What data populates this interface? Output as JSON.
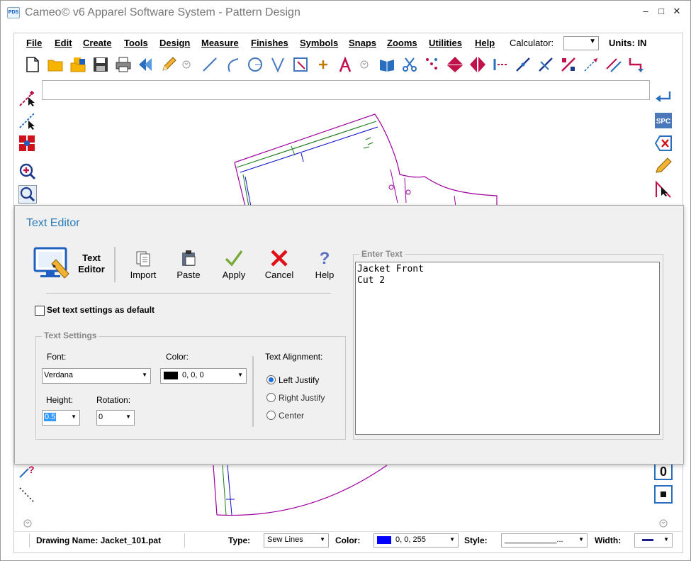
{
  "window": {
    "title": "Cameo© v6 Apparel Software System - Pattern Design",
    "icon_text": "PDS",
    "minimize": "–",
    "maximize": "□",
    "close": "✕"
  },
  "menu": {
    "items": [
      "File",
      "Edit",
      "Create",
      "Tools",
      "Design",
      "Measure",
      "Finishes",
      "Symbols",
      "Snaps",
      "Zooms",
      "Utilities",
      "Help"
    ],
    "calculator_label": "Calculator:",
    "units_label": "Units: IN"
  },
  "toolbar": {
    "icons": [
      "new-file-icon",
      "open-folder-icon",
      "open-multiple-icon",
      "save-icon",
      "print-icon",
      "back-arrow-icon",
      "pencil-icon",
      "expand-icon",
      "line-icon",
      "curve-icon",
      "circle-icon",
      "dart-icon",
      "rectangle-icon",
      "plus-icon",
      "text-icon",
      "expand-icon",
      "book-icon",
      "scissors-icon",
      "points-icon",
      "mirror-vertical-icon",
      "mirror-horizontal-icon",
      "notch-line-icon",
      "cut-line-icon",
      "intersect-icon",
      "mark-icon",
      "measure-line-icon",
      "parallel-icon",
      "corner-icon"
    ]
  },
  "right_toolbar": {
    "spc_label": "SPC",
    "counter_value": "0"
  },
  "dialog": {
    "title": "Text Editor",
    "header_label_line1": "Text",
    "header_label_line2": "Editor",
    "buttons": {
      "import": "Import",
      "paste": "Paste",
      "apply": "Apply",
      "cancel": "Cancel",
      "help": "Help"
    },
    "default_checkbox_label": "Set text settings as default",
    "default_checked": false,
    "settings": {
      "group_title": "Text Settings",
      "font_label": "Font:",
      "font_value": "Verdana",
      "color_label": "Color:",
      "color_value": "0, 0, 0",
      "color_swatch": "#000000",
      "height_label": "Height:",
      "height_value": "0.5",
      "rotation_label": "Rotation:",
      "rotation_value": "0",
      "alignment_label": "Text Alignment:",
      "alignment_options": [
        "Left Justify",
        "Right Justify",
        "Center"
      ],
      "alignment_selected": "Left Justify"
    },
    "enter_text": {
      "group_title": "Enter Text",
      "lines": [
        "Jacket Front",
        "Cut 2"
      ]
    }
  },
  "statusbar": {
    "drawing_name_label": "Drawing Name: Jacket_101.pat",
    "type_label": "Type:",
    "type_value": "Sew Lines",
    "color_label": "Color:",
    "color_value": "0, 0, 255",
    "color_swatch": "#0000ff",
    "style_label": "Style:",
    "style_value": "____________...",
    "width_label": "Width:"
  },
  "colors": {
    "accent": "#2a7ab8",
    "pattern_outline": "#a000a0",
    "pattern_green": "#1a7a1a",
    "pattern_blue": "#1010cc"
  }
}
